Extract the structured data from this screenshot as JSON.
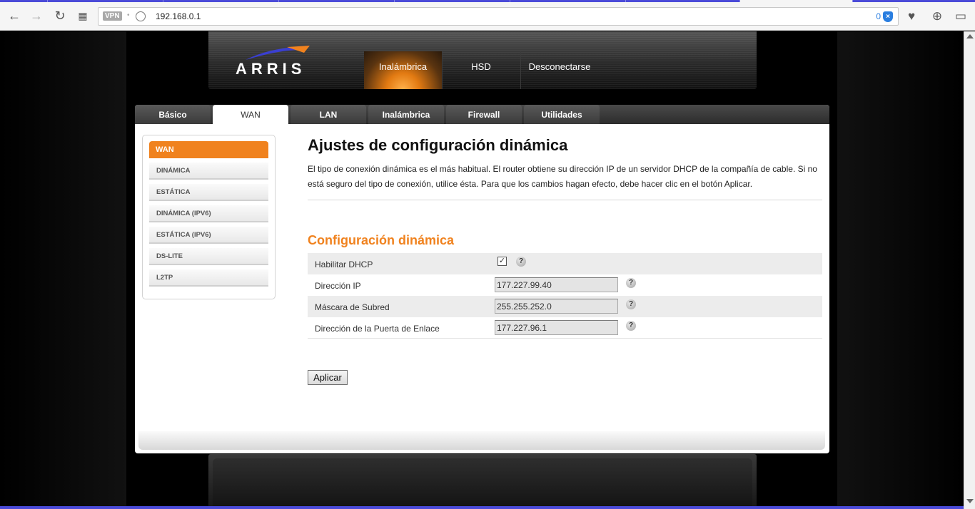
{
  "browser": {
    "vpn_label": "VPN",
    "url": "192.168.0.1",
    "ad_count": "0"
  },
  "header": {
    "logo_text": "ARRIS",
    "nav": [
      {
        "label": "Inalámbrica",
        "active": true
      },
      {
        "label": "HSD",
        "active": false
      },
      {
        "label": "Desconectarse",
        "active": false
      }
    ]
  },
  "tabs": [
    {
      "label": "Básico",
      "active": false
    },
    {
      "label": "WAN",
      "active": true
    },
    {
      "label": "LAN",
      "active": false
    },
    {
      "label": "Inalámbrica",
      "active": false
    },
    {
      "label": "Firewall",
      "active": false
    },
    {
      "label": "Utilidades",
      "active": false
    }
  ],
  "sidebar": {
    "header": "WAN",
    "items": [
      "DINÁMICA",
      "ESTÁTICA",
      "DINÁMICA (IPV6)",
      "ESTÁTICA (IPV6)",
      "DS-LITE",
      "L2TP"
    ]
  },
  "main": {
    "title": "Ajustes de configuración dinámica",
    "description": "El tipo de conexión dinámica es el más habitual. El router obtiene su dirección IP de un servidor DHCP de la compañía de cable. Si no está seguro del tipo de conexión, utilice ésta. Para que los cambios hagan efecto, debe hacer clic en el botón Aplicar.",
    "section_title": "Configuración dinámica",
    "dhcp_label": "Habilitar DHCP",
    "dhcp_enabled": true,
    "ip_label": "Dirección IP",
    "ip_value": "177.227.99.40",
    "mask_label": "Máscara de Subred",
    "mask_value": "255.255.252.0",
    "gateway_label": "Dirección de la Puerta de Enlace",
    "gateway_value": "177.227.96.1",
    "help_symbol": "?",
    "apply_label": "Aplicar"
  },
  "colors": {
    "accent": "#f0821e",
    "dark": "#2c2c2c"
  }
}
